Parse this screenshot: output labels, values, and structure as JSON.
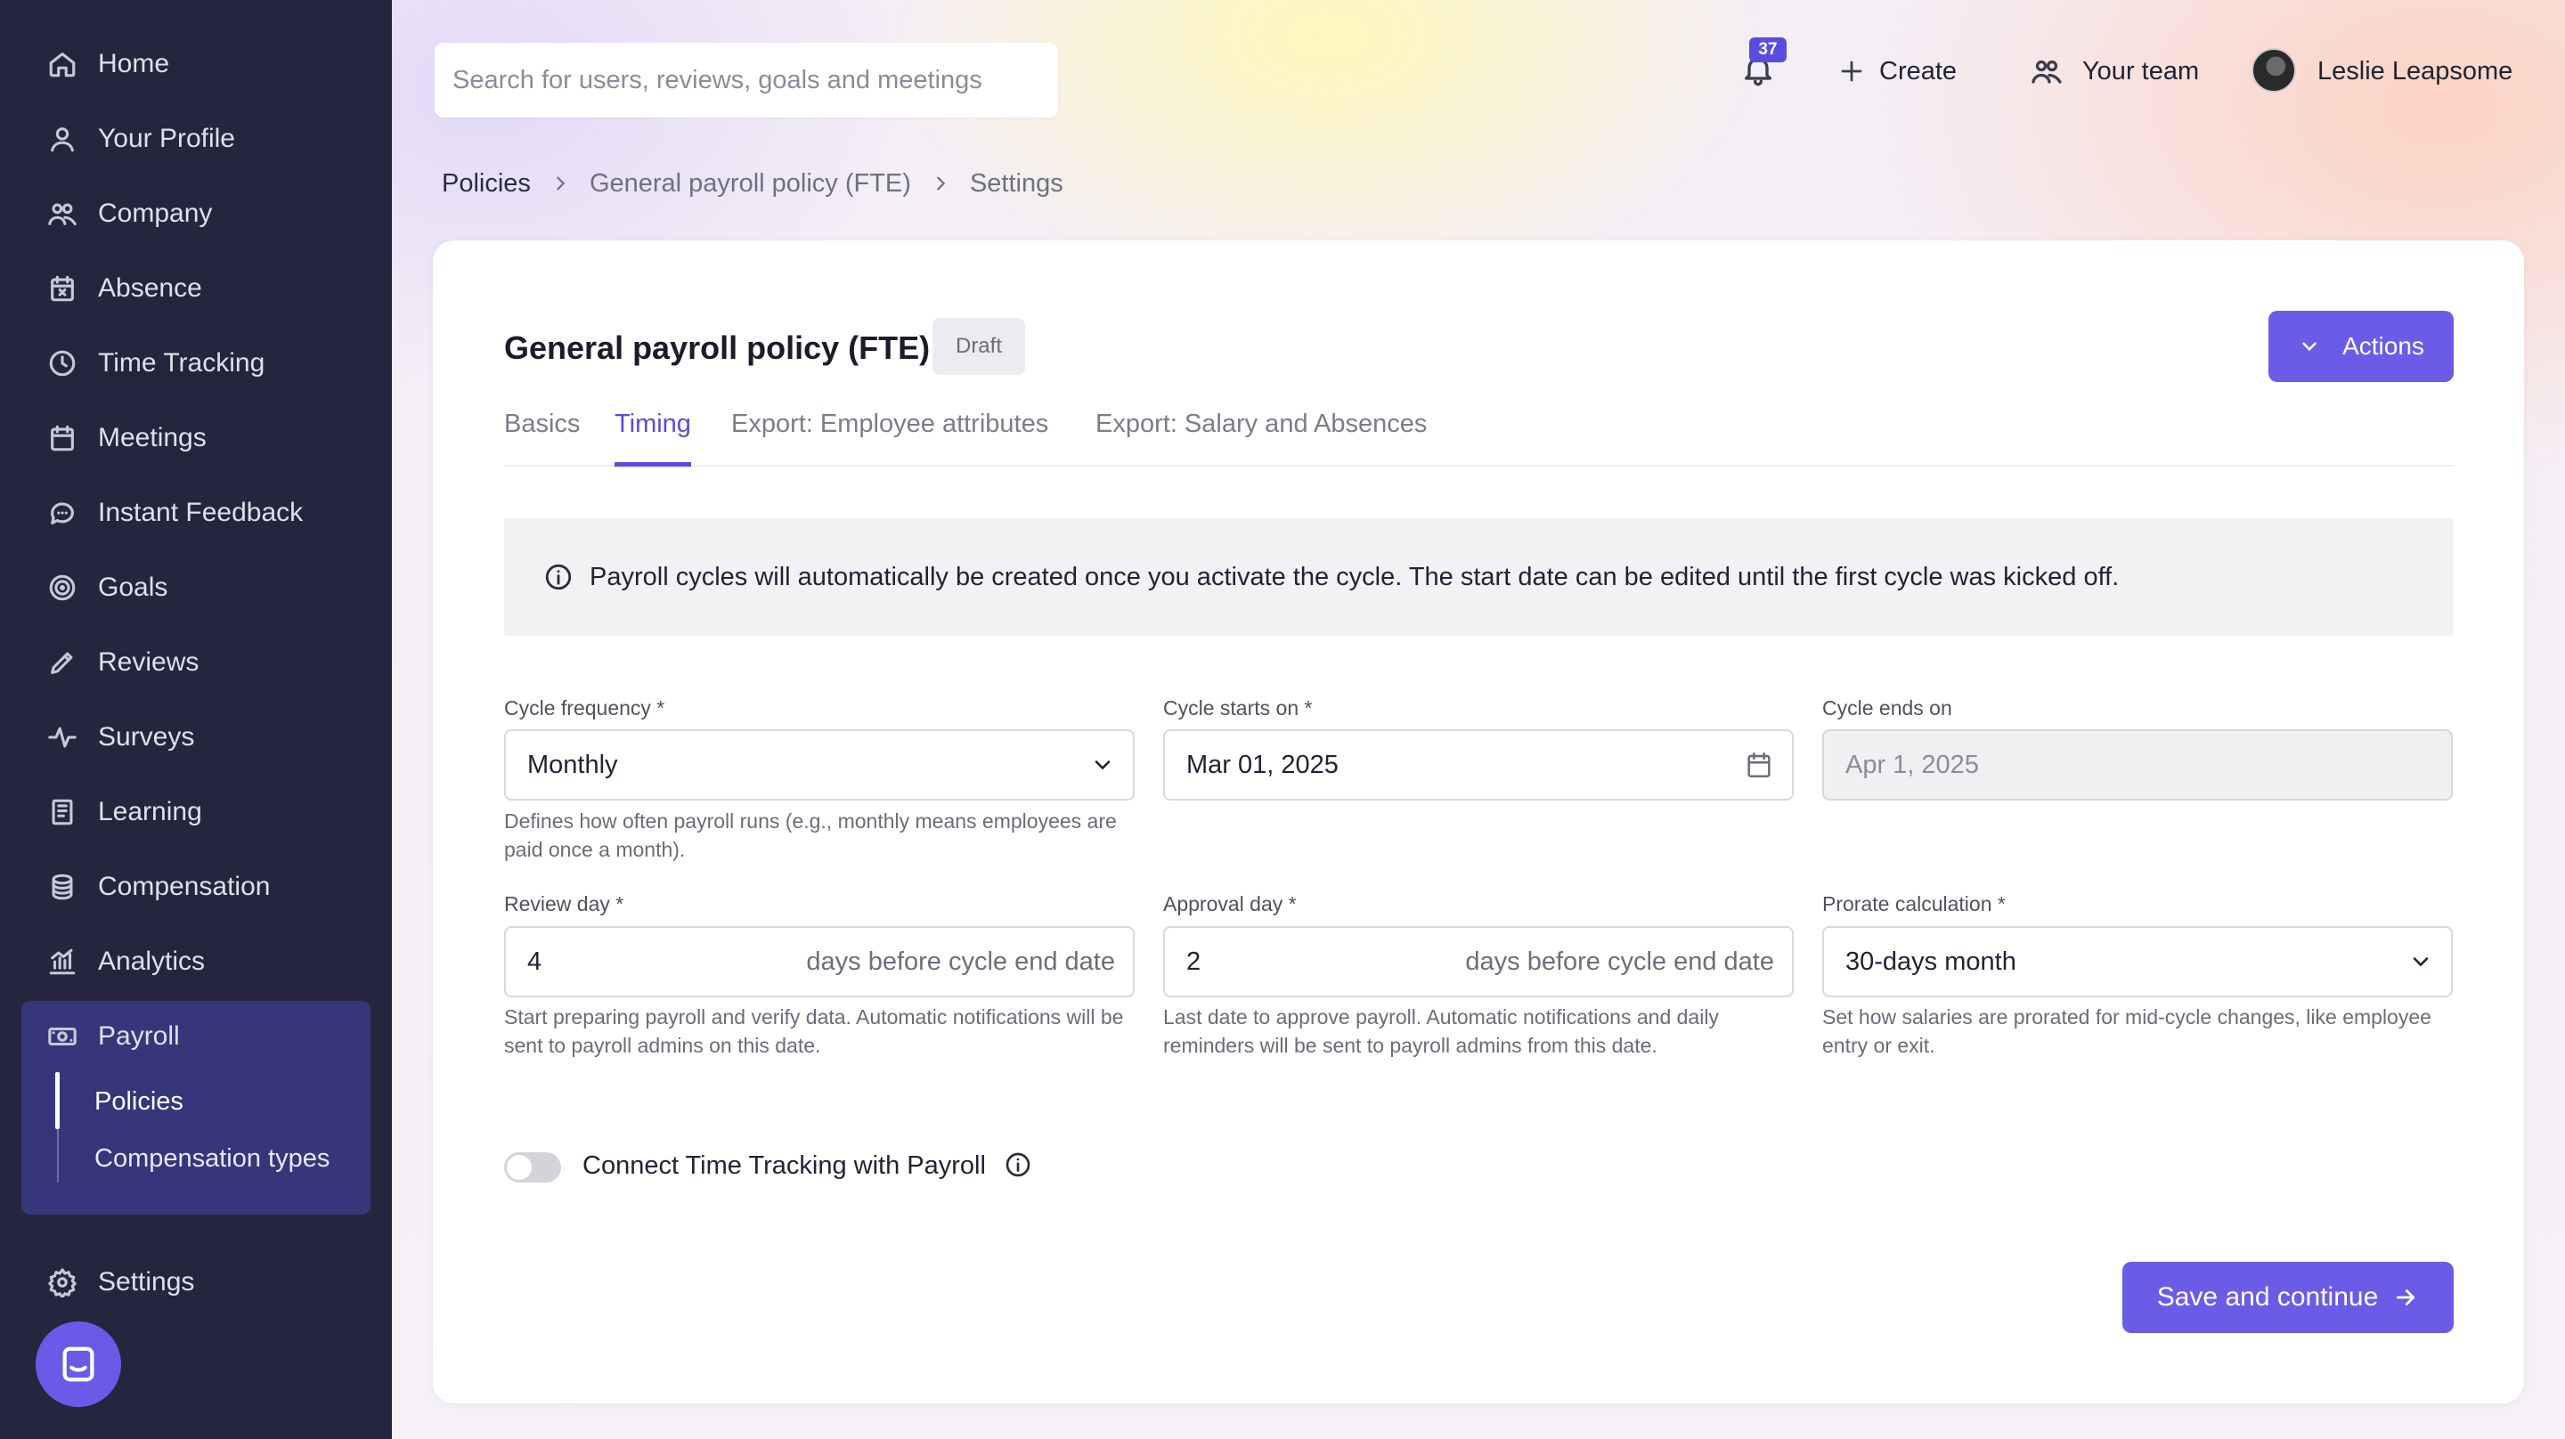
{
  "sidebar": {
    "items": [
      {
        "label": "Home",
        "icon": "home-icon"
      },
      {
        "label": "Your Profile",
        "icon": "user-icon"
      },
      {
        "label": "Company",
        "icon": "people-icon"
      },
      {
        "label": "Absence",
        "icon": "calendar-x-icon"
      },
      {
        "label": "Time Tracking",
        "icon": "clock-icon"
      },
      {
        "label": "Meetings",
        "icon": "calendar-icon"
      },
      {
        "label": "Instant Feedback",
        "icon": "chat-icon"
      },
      {
        "label": "Goals",
        "icon": "target-icon"
      },
      {
        "label": "Reviews",
        "icon": "pencil-icon"
      },
      {
        "label": "Surveys",
        "icon": "pulse-icon"
      },
      {
        "label": "Learning",
        "icon": "book-icon"
      },
      {
        "label": "Compensation",
        "icon": "coins-icon"
      },
      {
        "label": "Analytics",
        "icon": "chart-icon"
      }
    ],
    "payroll": {
      "label": "Payroll",
      "icon": "money-icon",
      "subitems": [
        "Policies",
        "Compensation types"
      ],
      "active_sub": "Policies"
    },
    "settings": {
      "label": "Settings",
      "icon": "gear-icon"
    }
  },
  "header": {
    "search_placeholder": "Search for users, reviews, goals and meetings",
    "notifications_count": "37",
    "create_label": "Create",
    "team_label": "Your team",
    "user_name": "Leslie Leapsome"
  },
  "breadcrumb": [
    "Policies",
    "General payroll policy (FTE)",
    "Settings"
  ],
  "page": {
    "title": "General payroll policy (FTE)",
    "status": "Draft",
    "actions_label": "Actions",
    "tabs": [
      "Basics",
      "Timing",
      "Export: Employee attributes",
      "Export: Salary and Absences"
    ],
    "active_tab": "Timing",
    "info": "Payroll cycles will automatically be created once you activate the cycle. The start date can be edited until the first cycle was kicked off."
  },
  "form": {
    "cycle_frequency": {
      "label": "Cycle frequency *",
      "value": "Monthly",
      "help": "Defines how often payroll runs (e.g., monthly means employees are paid once a month)."
    },
    "cycle_starts": {
      "label": "Cycle starts on *",
      "value": "Mar 01, 2025"
    },
    "cycle_ends": {
      "label": "Cycle ends on",
      "value": "Apr 1, 2025"
    },
    "review_day": {
      "label": "Review day *",
      "value": "4",
      "suffix": "days before cycle end date",
      "help": "Start preparing payroll and verify data. Automatic notifications will be sent to payroll admins on this date."
    },
    "approval_day": {
      "label": "Approval day *",
      "value": "2",
      "suffix": "days before cycle end date",
      "help": "Last date to approve payroll. Automatic notifications and daily reminders will be sent to payroll admins from this date."
    },
    "prorate": {
      "label": "Prorate calculation *",
      "value": "30-days month",
      "help": "Set how salaries are prorated for mid-cycle changes, like employee entry or exit."
    },
    "time_tracking_toggle": {
      "label": "Connect Time Tracking with Payroll",
      "enabled": false
    }
  },
  "footer": {
    "save_label": "Save and continue"
  },
  "colors": {
    "accent": "#6a5ce6",
    "sidebar_bg": "#25263d",
    "payroll_active_bg": "#35377a"
  }
}
